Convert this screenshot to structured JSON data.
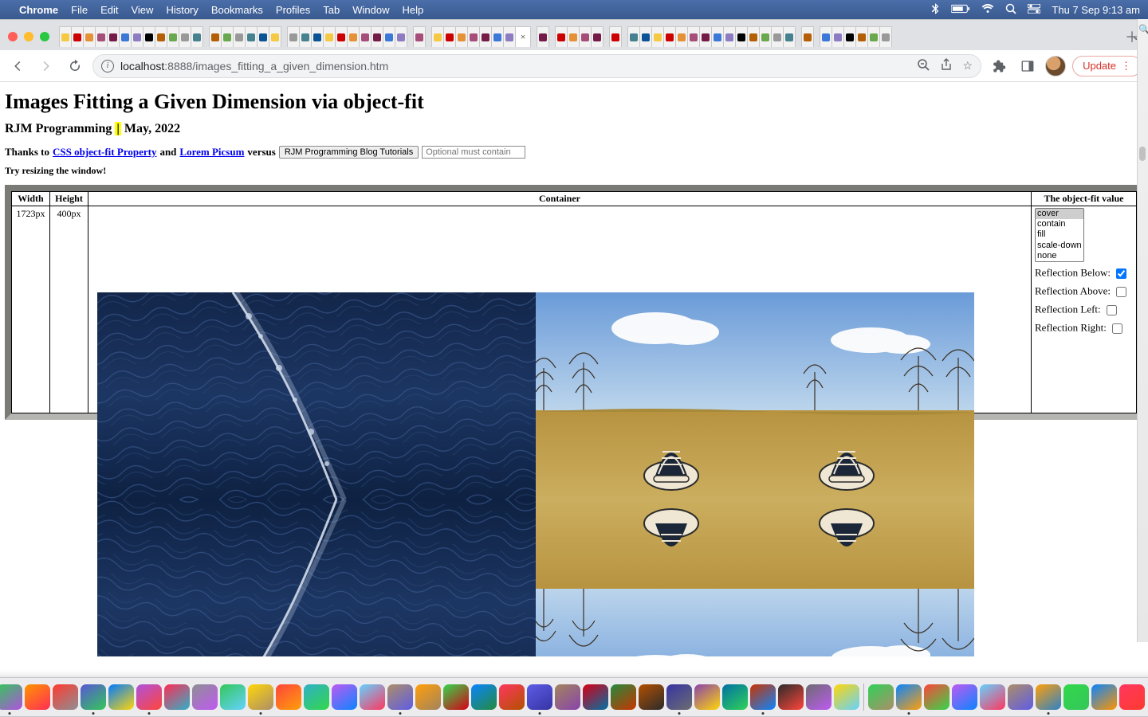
{
  "mac_menu": {
    "app": "Chrome",
    "items": [
      "File",
      "Edit",
      "View",
      "History",
      "Bookmarks",
      "Profiles",
      "Tab",
      "Window",
      "Help"
    ],
    "clock": "Thu 7 Sep  9:13 am"
  },
  "chrome": {
    "url_host": "localhost",
    "url_port": ":8888",
    "url_path": "/images_fitting_a_given_dimension.htm",
    "update_label": "Update",
    "new_tab_tooltip": "+"
  },
  "page": {
    "title": "Images Fitting a Given Dimension via object-fit",
    "subtitle_left": "RJM Programming",
    "subtitle_sep": "|",
    "subtitle_right": "May, 2022",
    "thanks_prefix": "Thanks to ",
    "link1": "CSS object-fit Property",
    "and": " and ",
    "link2": "Lorem Picsum",
    "versus": " versus ",
    "button_label": "RJM Programming Blog Tutorials",
    "input_placeholder": "Optional must contain",
    "try_line": "Try resizing the window!",
    "table": {
      "th_width": "Width",
      "th_height": "Height",
      "th_container": "Container",
      "th_objfit": "The object-fit value",
      "width_val": "1723px",
      "height_val": "400px"
    },
    "objfit_options": [
      "cover",
      "contain",
      "fill",
      "scale-down",
      "none"
    ],
    "objfit_selected": "cover",
    "reflections": {
      "below": {
        "label": "Reflection Below:",
        "checked": true
      },
      "above": {
        "label": "Reflection Above:",
        "checked": false
      },
      "left": {
        "label": "Reflection Left:",
        "checked": false
      },
      "right": {
        "label": "Reflection Right:",
        "checked": false
      }
    }
  }
}
